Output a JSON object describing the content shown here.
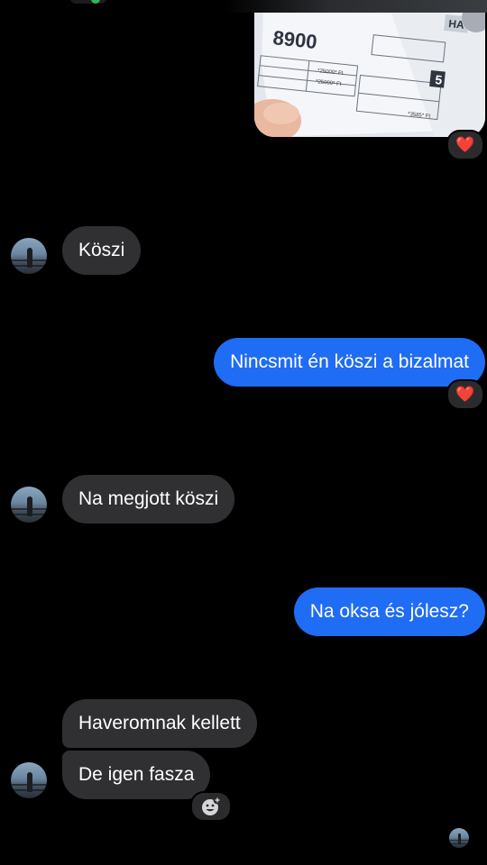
{
  "colors": {
    "background": "#000000",
    "incoming_bubble": "#303033",
    "outgoing_bubble": "#1f6cf5",
    "reaction_heart": "#e0242f"
  },
  "photo_message": {
    "visible_text": {
      "amount": "8900",
      "price1": "*25000* Ft",
      "price2": "*25000* Ft",
      "price3": "*3585* Ft",
      "number": "5",
      "brand": "HA"
    }
  },
  "messages": [
    {
      "id": "m1",
      "side": "incoming",
      "text": "Köszi"
    },
    {
      "id": "m2",
      "side": "outgoing",
      "text": "Nincsmit én köszi a bizalmat",
      "reaction": "❤️"
    },
    {
      "id": "m3",
      "side": "incoming",
      "text": "Na megjott köszi"
    },
    {
      "id": "m4",
      "side": "outgoing",
      "text": "Na oksa és jólesz?"
    },
    {
      "id": "m5",
      "side": "incoming",
      "text": "Haveromnak kellett"
    },
    {
      "id": "m6",
      "side": "incoming",
      "text": "De igen fasza"
    }
  ],
  "reactions": {
    "photo": "❤️",
    "m2": "❤️"
  },
  "icons": {
    "add_reaction": "smiley-plus-icon",
    "heart": "heart-icon",
    "avatar": "avatar",
    "read_receipt": "read-receipt-avatar"
  }
}
